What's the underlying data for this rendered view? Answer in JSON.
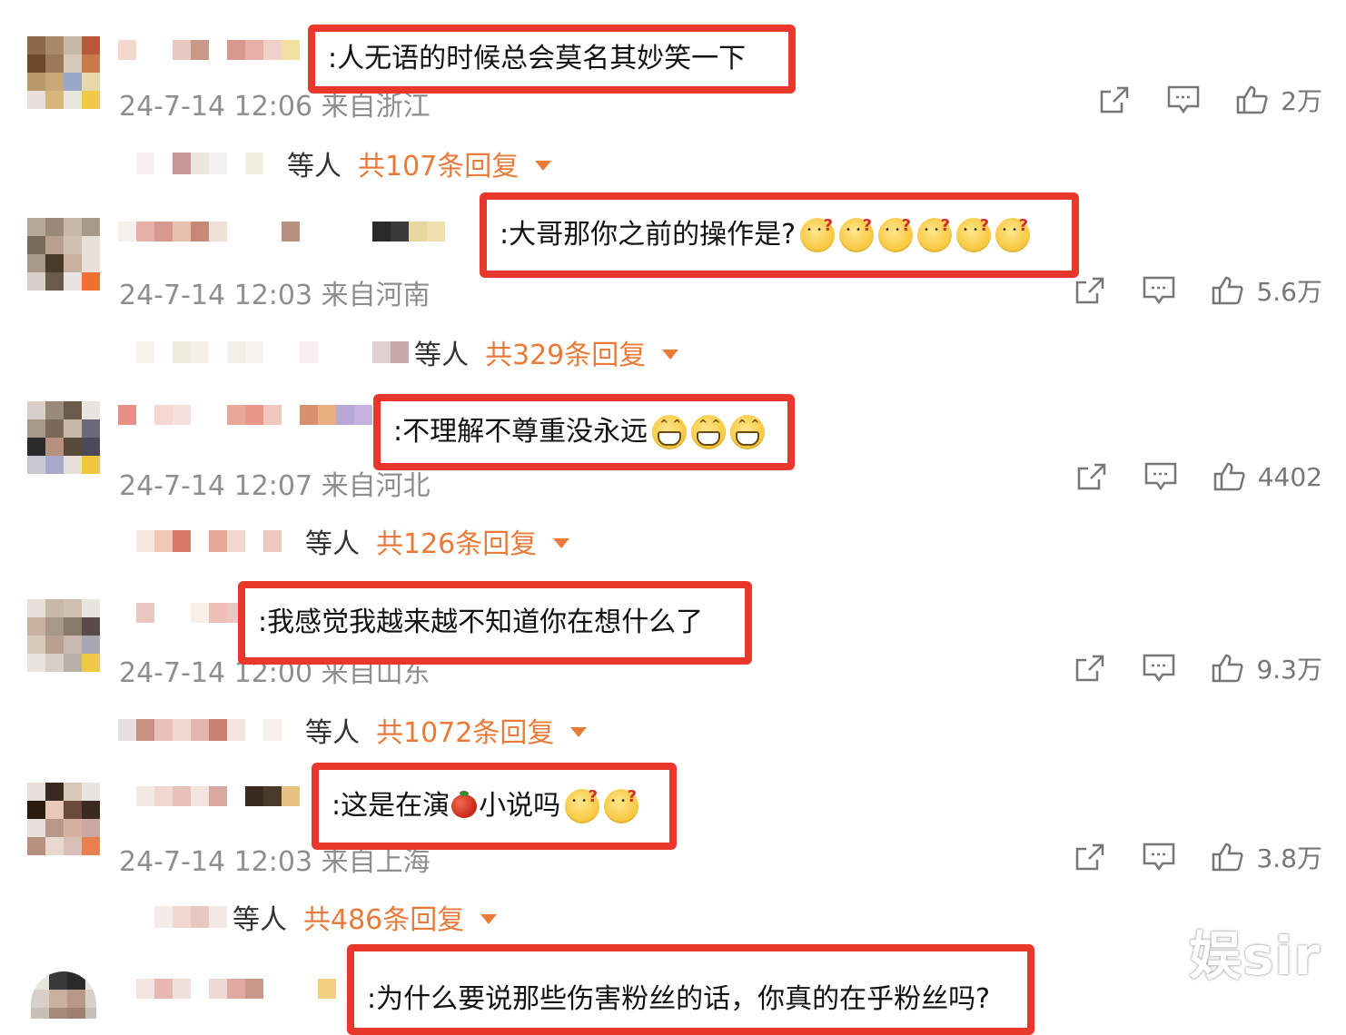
{
  "comments": [
    {
      "text": ":人无语的时候总会莫名其妙笑一下",
      "emojis": [],
      "time": "24-7-14 12:06 来自浙江",
      "likes": "2万",
      "reply_who": "等人",
      "reply_count": "共107条回复"
    },
    {
      "text": ":大哥那你之前的操作是?",
      "emojis": [
        "confused",
        "confused",
        "confused",
        "confused",
        "confused",
        "confused"
      ],
      "time": "24-7-14 12:03 来自河南",
      "likes": "5.6万",
      "reply_who": "等人",
      "reply_count": "共329条回复"
    },
    {
      "text": ":不理解不尊重没永远",
      "emojis": [
        "grin",
        "grin",
        "grin"
      ],
      "time": "24-7-14 12:07 来自河北",
      "likes": "4402",
      "reply_who": "等人",
      "reply_count": "共126条回复"
    },
    {
      "text": ":我感觉我越来越不知道你在想什么了",
      "emojis": [],
      "time": "24-7-14 12:00 来自山东",
      "likes": "9.3万",
      "reply_who": "等人",
      "reply_count": "共1072条回复"
    },
    {
      "text_before": ":这是在演",
      "text_after": "小说吗",
      "emojis": [
        "confused",
        "confused"
      ],
      "time": "24-7-14 12:03 来自上海",
      "likes": "3.8万",
      "reply_who": "等人",
      "reply_count": "共486条回复"
    },
    {
      "text": ":为什么要说那些伤害粉丝的话，你真的在乎粉丝吗?"
    }
  ],
  "watermark": "娱sir",
  "colors": {
    "highlight_border": "#e9372c",
    "reply_link": "#ea7a3a",
    "meta_text": "#8e8e8e"
  },
  "icons": [
    "share-icon",
    "comment-icon",
    "like-icon",
    "dropdown-caret-icon"
  ]
}
